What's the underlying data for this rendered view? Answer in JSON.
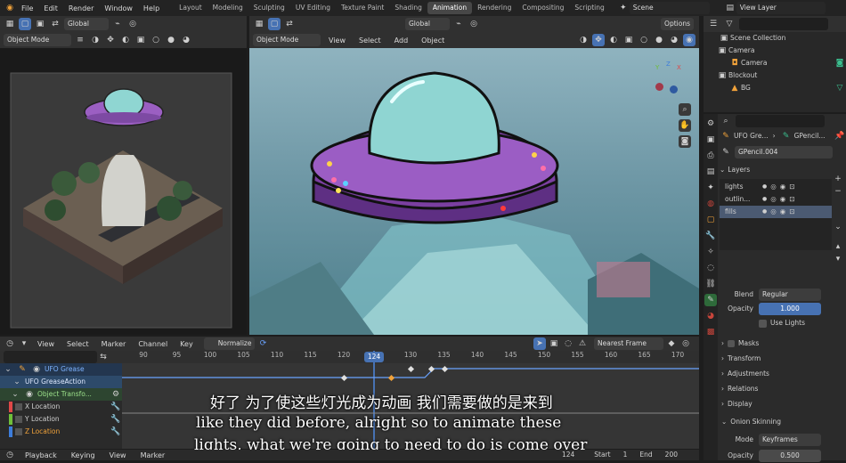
{
  "topbar": {
    "menus": [
      "File",
      "Edit",
      "Render",
      "Window",
      "Help"
    ],
    "tabs": [
      "Layout",
      "Modeling",
      "Sculpting",
      "UV Editing",
      "Texture Paint",
      "Shading",
      "Animation",
      "Rendering",
      "Compositing",
      "Scripting"
    ],
    "active_tab": "Animation",
    "scene": "Scene",
    "view_layer": "View Layer"
  },
  "left_viewport": {
    "mode": "Object Mode",
    "orientation": "Global"
  },
  "main_viewport": {
    "mode": "Object Mode",
    "menus": [
      "View",
      "Select",
      "Add",
      "Object"
    ],
    "orientation": "Global",
    "options": "Options",
    "gizmo": {
      "x": "X",
      "y": "Y",
      "z": "Z"
    }
  },
  "outliner": {
    "items": [
      {
        "label": "Scene Collection"
      },
      {
        "label": "Camera"
      },
      {
        "label": "Camera"
      },
      {
        "label": "Blockout"
      },
      {
        "label": "BG"
      }
    ]
  },
  "properties": {
    "object": "UFO Gre...",
    "data": "GPencil...",
    "datablock": "GPencil.004",
    "layers_title": "Layers",
    "layers": [
      "lights",
      "outlin...",
      "fills"
    ],
    "blend_label": "Blend",
    "blend_value": "Regular",
    "opacity_label": "Opacity",
    "opacity_value": "1.000",
    "use_lights": "Use Lights",
    "sections": [
      "Masks",
      "Transform",
      "Adjustments",
      "Relations",
      "Display"
    ],
    "onion_title": "Onion Skinning",
    "mode_label": "Mode",
    "mode_value": "Keyframes",
    "onion_opacity_label": "Opacity",
    "onion_opacity_value": "0.500"
  },
  "timeline": {
    "menus": [
      "View",
      "Select",
      "Marker",
      "Channel",
      "Key"
    ],
    "normalize": "Normalize",
    "interp": "Nearest Frame",
    "ticks": [
      "90",
      "95",
      "100",
      "105",
      "110",
      "115",
      "120",
      "124",
      "130",
      "135",
      "140",
      "145",
      "150",
      "155",
      "160",
      "165",
      "170"
    ],
    "current_frame": "124",
    "channels": [
      "UFO Grease",
      "UFO GreaseAction",
      "Object Transfo...",
      "X Location",
      "Y Location",
      "Z Location"
    ],
    "keyframes_x": [
      120,
      127,
      130,
      133,
      135
    ]
  },
  "playback_bar": {
    "items": [
      "Playback",
      "Keying",
      "View",
      "Marker"
    ],
    "frame": "124",
    "start_label": "Start",
    "start": "1",
    "end_label": "End",
    "end": "200"
  },
  "subtitles": {
    "zh": "好了 为了使这些灯光成为动画 我们需要做的是来到",
    "en1": "like they did before, alright so to animate these",
    "en2": "lights, what we're going to need to do is come over"
  }
}
